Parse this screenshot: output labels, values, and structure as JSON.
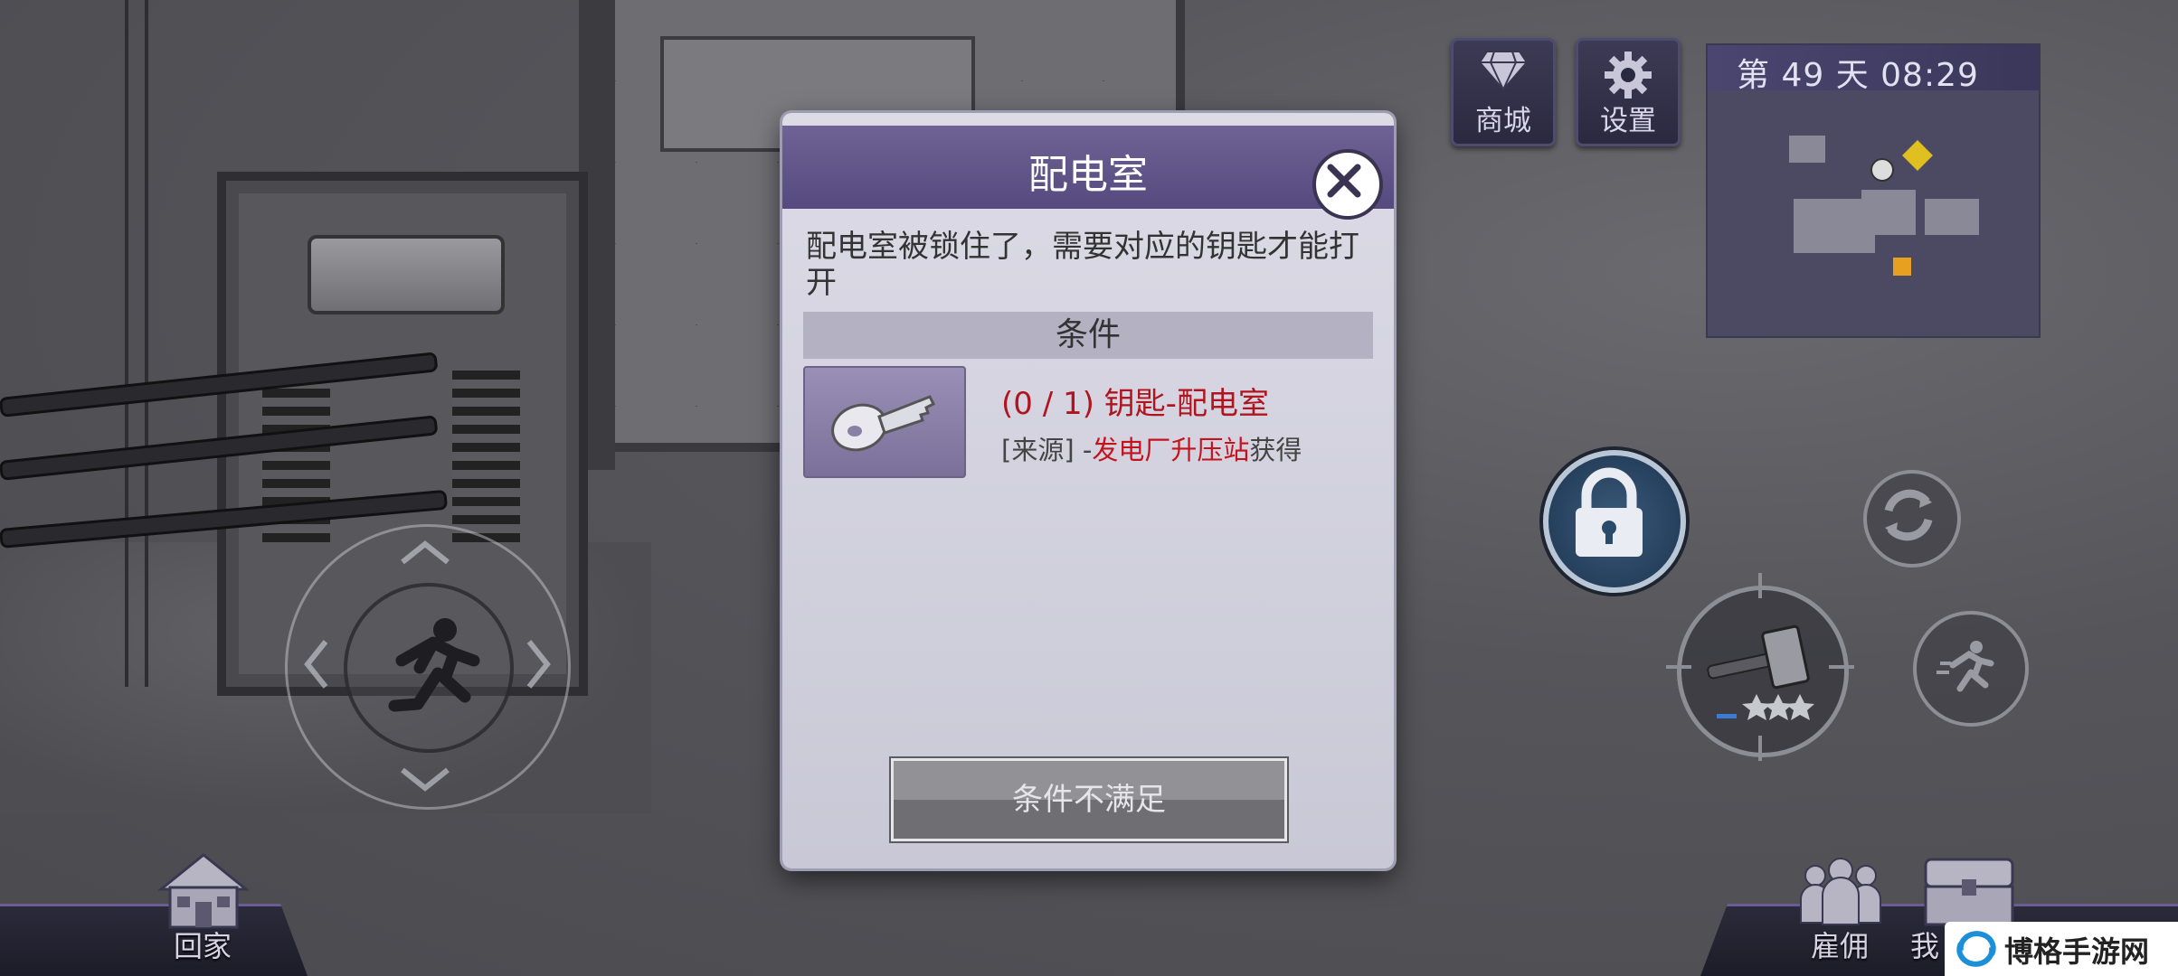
{
  "hud": {
    "shop_label": "商城",
    "settings_label": "设置",
    "day_time": "第 49 天  08:29",
    "home_label": "回家",
    "hire_label": "雇佣",
    "me_label": "我"
  },
  "dialog": {
    "title": "配电室",
    "description": "配电室被锁住了，需要对应的钥匙才能打开",
    "condition_header": "条件",
    "requirement": "(0 / 1) 钥匙-配电室",
    "source_prefix": "[来源] -",
    "source_place": "发电厂升压站",
    "source_suffix": "获得",
    "action_button": "条件不满足"
  },
  "watermark": {
    "text": "博格手游网"
  },
  "colors": {
    "dialog_header": "#6f6396",
    "requirement_red": "#b0141e",
    "lock_button": "#2a4a6a"
  },
  "icons": [
    "diamond-icon",
    "gear-icon",
    "close-icon",
    "key-icon",
    "lock-icon",
    "sync-icon",
    "run-icon",
    "hammer-icon",
    "house-icon",
    "people-icon",
    "chest-icon",
    "runner-icon"
  ]
}
